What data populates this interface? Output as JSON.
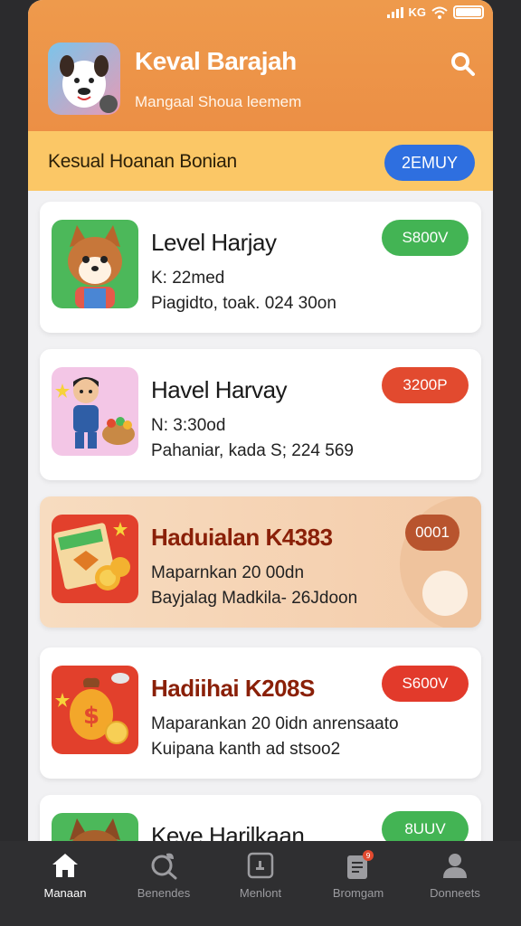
{
  "status_bar": {
    "signal_text": "KG"
  },
  "header": {
    "title": "Keval Barajah",
    "subtitle": "Mangaal Shoua leemem",
    "search_icon": "search-icon"
  },
  "banner": {
    "text": "Kesual Hoanan Bonian",
    "pill": "2EMUY"
  },
  "cards": [
    {
      "title": "Level Harjay",
      "line1": "K: 22med",
      "line2": "Piagidto, toak. 024 30on",
      "pill": "S800V",
      "pill_color": "#43b454"
    },
    {
      "title": "Havel Harvay",
      "line1": "N: 3:30od",
      "line2": "Pahaniar, kada S; 224 569",
      "pill": "3200P",
      "pill_color": "#e24a2f"
    },
    {
      "title": "Haduialan K4383",
      "line1": "Maparnkan 20 00dn",
      "line2": "Bayjalag Madkila- 26Jdoon",
      "pill": "0001",
      "pill_color": "#b8542e"
    },
    {
      "title": "Hadiihai K208S",
      "line1": "Maparankan 20 0idn anrensaato",
      "line2": "Kuipana kanth ad stsoo2",
      "pill": "S600V",
      "pill_color": "#e23a2b"
    },
    {
      "title": "Keve Harilkaan",
      "pill": "8UUV",
      "pill_color": "#43b454"
    }
  ],
  "tabbar": {
    "items": [
      {
        "label": "Manaan",
        "icon": "home-icon"
      },
      {
        "label": "Benendes",
        "icon": "search-leaf-icon"
      },
      {
        "label": "Menlont",
        "icon": "calendar-icon"
      },
      {
        "label": "Bromgam",
        "icon": "clipboard-icon",
        "badge": "9"
      },
      {
        "label": "Donneets",
        "icon": "profile-icon"
      }
    ]
  },
  "colors": {
    "header": "#ec8f45",
    "banner": "#fbc766",
    "accent_blue": "#2e6fe0",
    "green": "#43b454",
    "red": "#e24a2f"
  }
}
